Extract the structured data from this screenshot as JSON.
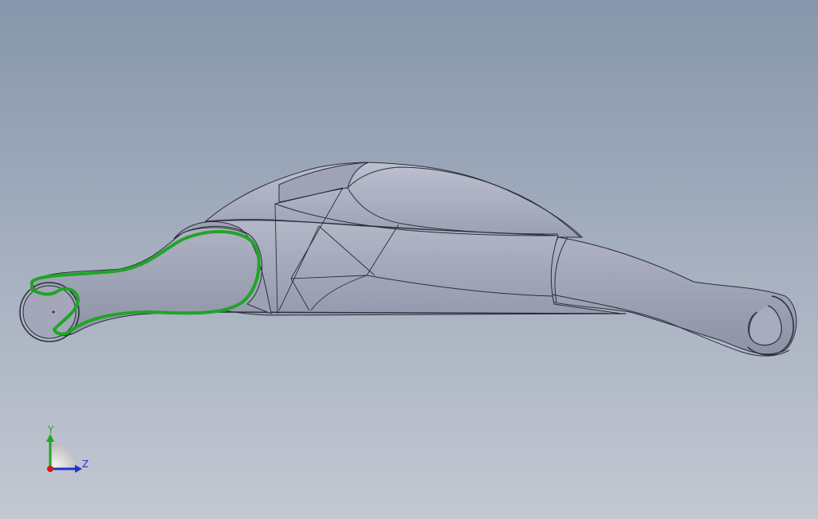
{
  "viewport": {
    "background_top": "#8796ab",
    "background_bottom": "#c3c8d2"
  },
  "model": {
    "body_fill": "#a3a8bb",
    "body_shadow": "#8f94a8",
    "edge_color": "#2a2d38",
    "selected_edge_color": "#1fa526"
  },
  "triad": {
    "y_label": "Y",
    "z_label": "Z",
    "y_color": "#1fa526",
    "z_color": "#2233c8",
    "x_color": "#c81e1e"
  }
}
